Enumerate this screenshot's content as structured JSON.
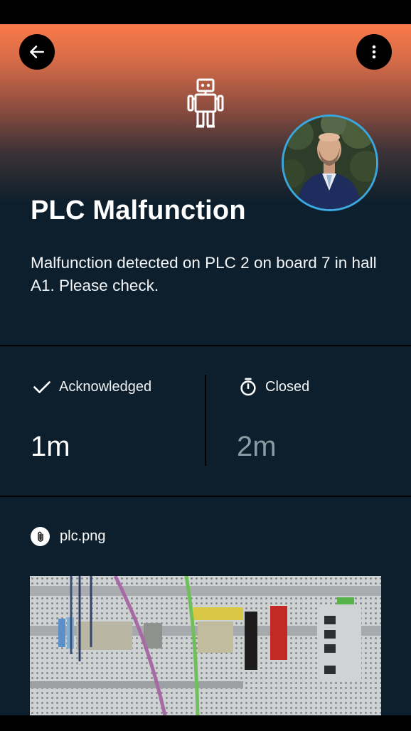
{
  "header": {
    "back_icon": "arrow-left-icon",
    "menu_icon": "more-vertical-icon",
    "category_icon": "robot-icon"
  },
  "incident": {
    "title": "PLC Malfunction",
    "description": "Malfunction detected on PLC 2 on board 7 in hall A1. Please check."
  },
  "stats": {
    "acknowledged": {
      "label": "Acknowledged",
      "value": "1m",
      "icon": "check-icon"
    },
    "closed": {
      "label": "Closed",
      "value": "2m",
      "icon": "stopwatch-icon"
    }
  },
  "attachment": {
    "filename": "plc.png",
    "icon": "paperclip-icon"
  },
  "colors": {
    "gradient_top": "#fb7a4a",
    "background": "#0d1f2c",
    "avatar_ring": "#3aa7de",
    "muted_value": "#8b9aa3"
  }
}
